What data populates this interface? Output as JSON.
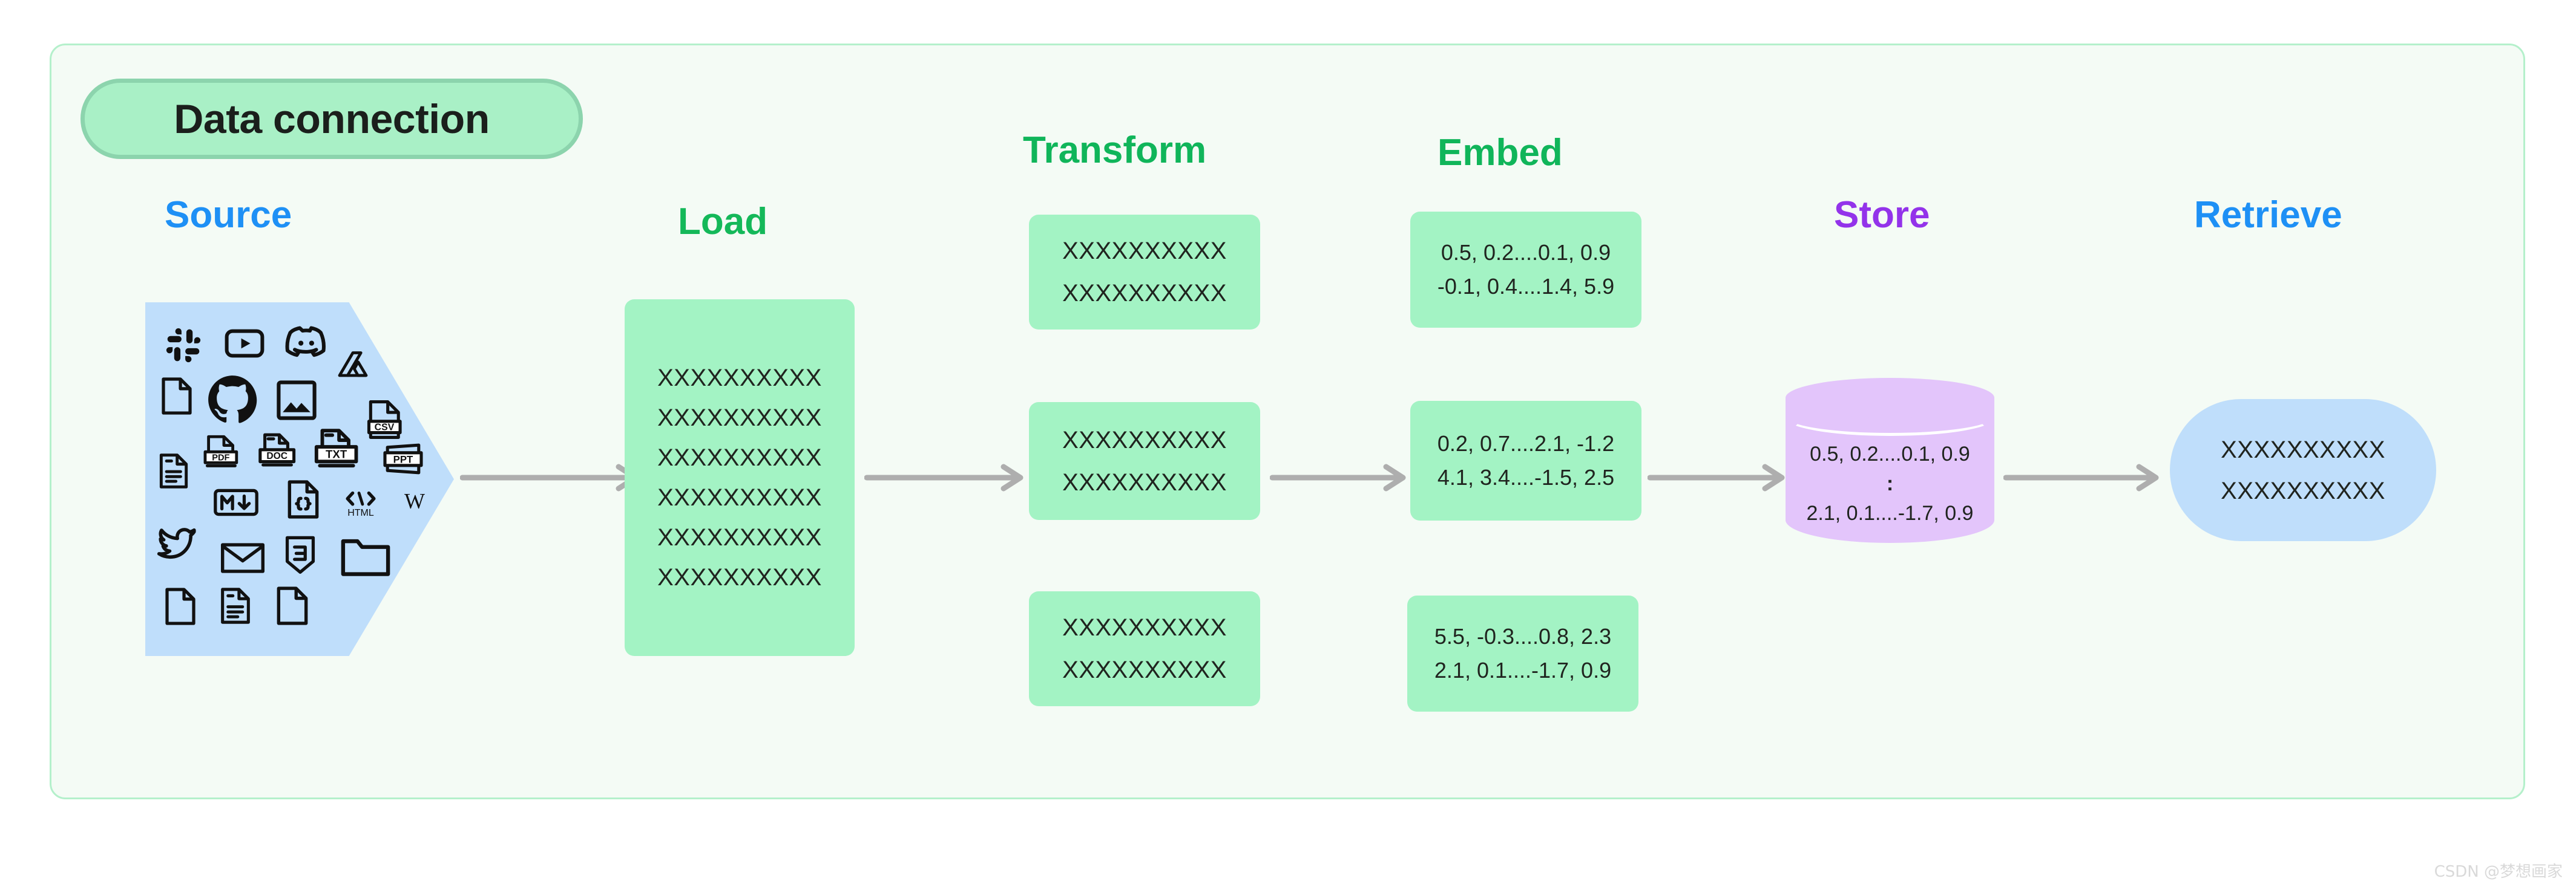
{
  "badge": {
    "label": "Data connection"
  },
  "colors": {
    "source_blue": "#1e90f5",
    "load_green": "#14b859",
    "transform_green": "#10b55a",
    "embed_green": "#10b55a",
    "store_purple": "#9333ea",
    "retrieve_blue": "#1e90f5",
    "box_green_fill": "#a3f3c4",
    "source_fill": "#bfdefb",
    "store_fill": "#e3c5fb",
    "retrieve_fill": "#bfdefb",
    "arrow_gray": "#aeaeae",
    "canvas_bg": "#f4fbf5",
    "canvas_border": "#b4f0cb",
    "badge_fill": "#a9f0c6",
    "badge_border": "#8cd4ad"
  },
  "stages": [
    {
      "id": "source",
      "heading": "Source"
    },
    {
      "id": "load",
      "heading": "Load"
    },
    {
      "id": "transform",
      "heading": "Transform"
    },
    {
      "id": "embed",
      "heading": "Embed"
    },
    {
      "id": "store",
      "heading": "Store"
    },
    {
      "id": "retrieve",
      "heading": "Retrieve"
    }
  ],
  "source": {
    "icons": [
      "slack-icon",
      "youtube-icon",
      "discord-icon",
      "file-icon",
      "github-icon",
      "image-icon",
      "google-drive-icon",
      "csv-file-icon",
      "document-lines-icon",
      "pdf-file-icon",
      "doc-file-icon",
      "txt-file-icon",
      "ppt-file-icon",
      "markdown-icon",
      "json-code-file-icon",
      "html-icon",
      "wikipedia-icon",
      "twitter-icon",
      "email-icon",
      "css3-icon",
      "folder-icon",
      "file-plain-icon",
      "file-text-icon",
      "file-blank-icon"
    ]
  },
  "load": {
    "lines": [
      "XXXXXXXXXX",
      "XXXXXXXXXX",
      "XXXXXXXXXX",
      "XXXXXXXXXX",
      "XXXXXXXXXX",
      "XXXXXXXXXX"
    ]
  },
  "transform": {
    "boxes": [
      {
        "lines": [
          "XXXXXXXXXX",
          "XXXXXXXXXX"
        ]
      },
      {
        "lines": [
          "XXXXXXXXXX",
          "XXXXXXXXXX"
        ]
      },
      {
        "lines": [
          "XXXXXXXXXX",
          "XXXXXXXXXX"
        ]
      }
    ]
  },
  "embed": {
    "boxes": [
      {
        "lines": [
          "0.5, 0.2....0.1, 0.9",
          "-0.1, 0.4....1.4, 5.9"
        ]
      },
      {
        "lines": [
          "0.2, 0.7....2.1, -1.2",
          "4.1, 3.4....-1.5, 2.5"
        ]
      },
      {
        "lines": [
          "5.5, -0.3....0.8, 2.3",
          "2.1, 0.1....-1.7, 0.9"
        ]
      }
    ]
  },
  "store": {
    "lines": [
      "0.5, 0.2....0.1, 0.9",
      ":",
      "2.1, 0.1....-1.7, 0.9"
    ]
  },
  "retrieve": {
    "lines": [
      "XXXXXXXXXX",
      "XXXXXXXXXX"
    ]
  },
  "arrows": {
    "count": 5,
    "direction": "right"
  },
  "watermark": {
    "text": "CSDN @梦想画家"
  }
}
